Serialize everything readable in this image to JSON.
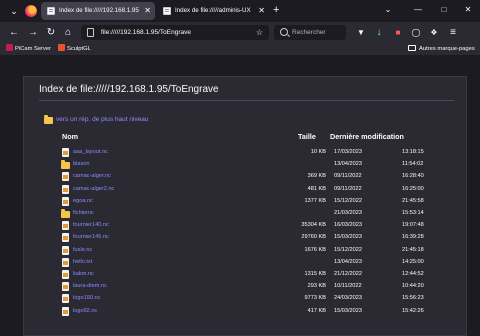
{
  "tabs": [
    {
      "title": "Index de file://///192.168.1.95/ToEngrave",
      "active": true
    },
    {
      "title": "Index de file://///adminis-UX",
      "active": false
    }
  ],
  "toolbar": {
    "url": "file://///192.168.1.95/ToEngrave",
    "search_placeholder": "Rechercher"
  },
  "bookmarks": {
    "items": [
      {
        "label": "PiCam Server",
        "icon": "raspberry-icon",
        "color": "#c51a4a"
      },
      {
        "label": "SculptGL",
        "icon": "sculptgl-icon",
        "color": "#e8532a"
      }
    ],
    "other": "Autres marque-pages"
  },
  "page": {
    "heading": "Index de file://///192.168.1.95/ToEngrave",
    "parent_link": "vers un rép. de plus haut niveau",
    "columns": {
      "name": "Nom",
      "size": "Taille",
      "modified": "Dernière modification"
    },
    "rows": [
      {
        "name": "aaa_layout.nc",
        "type": "file",
        "size": "10 KB",
        "date": "17/03/2023",
        "time": "13:18:15"
      },
      {
        "name": "blason",
        "type": "folder",
        "size": "",
        "date": "13/04/2023",
        "time": "11:54:02"
      },
      {
        "name": "camac-alger.nc",
        "type": "file",
        "size": "369 KB",
        "date": "09/11/2022",
        "time": "16:28:40"
      },
      {
        "name": "camac-alger2.nc",
        "type": "file",
        "size": "481 KB",
        "date": "09/11/2022",
        "time": "16:25:00"
      },
      {
        "name": "egoa.nc",
        "type": "file",
        "size": "1377 KB",
        "date": "15/12/2022",
        "time": "21:45:58"
      },
      {
        "name": "fichiernc",
        "type": "folder",
        "size": "",
        "date": "21/03/2023",
        "time": "15:53:14"
      },
      {
        "name": "fournier140.nc",
        "type": "file",
        "size": "35304 KB",
        "date": "16/03/2023",
        "time": "19:07:48"
      },
      {
        "name": "fournier145.nc",
        "type": "file",
        "size": "29760 KB",
        "date": "15/03/2023",
        "time": "16:39:28"
      },
      {
        "name": "fusle.nc",
        "type": "file",
        "size": "1676 KB",
        "date": "15/12/2022",
        "time": "21:45:18"
      },
      {
        "name": "hello.txt",
        "type": "file",
        "size": "",
        "date": "13/04/2023",
        "time": "14:25:00"
      },
      {
        "name": "kakm.nc",
        "type": "file",
        "size": "1315 KB",
        "date": "21/12/2022",
        "time": "12:44:52"
      },
      {
        "name": "laura-diem.nc",
        "type": "file",
        "size": "293 KB",
        "date": "10/11/2022",
        "time": "10:44:20"
      },
      {
        "name": "logo190.nc",
        "type": "file",
        "size": "9773 KB",
        "date": "24/03/2023",
        "time": "15:56:23"
      },
      {
        "name": "logo92.nc",
        "type": "file",
        "size": "417 KB",
        "date": "15/03/2023",
        "time": "15:42:26"
      }
    ]
  }
}
